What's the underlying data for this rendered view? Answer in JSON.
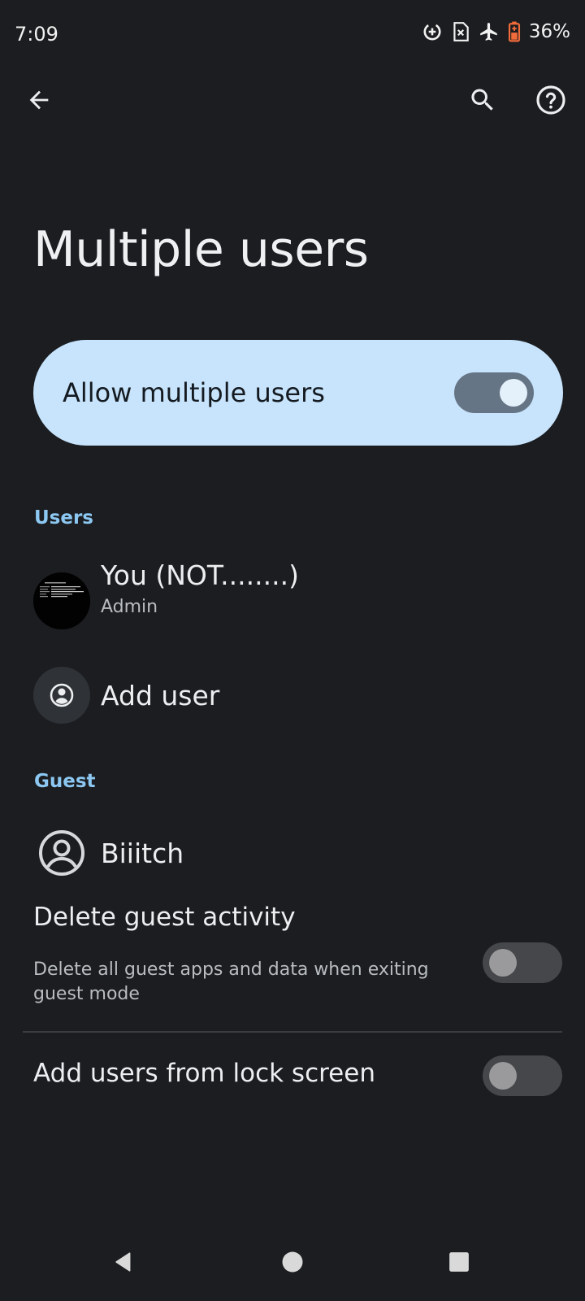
{
  "status_bar": {
    "time": "7:09",
    "battery_percent": "36%",
    "icons": [
      "data-saver-icon",
      "sim-off-icon",
      "airplane-mode-icon",
      "battery-saver-icon"
    ],
    "battery_color": "#f26b3a"
  },
  "app_bar": {
    "back_icon": "arrow-back-icon",
    "search_icon": "search-icon",
    "help_icon": "help-icon"
  },
  "page": {
    "title": "Multiple users"
  },
  "main_switch": {
    "label": "Allow multiple users",
    "checked": true,
    "background": "#c7e4fc"
  },
  "users_section": {
    "header": "Users",
    "current_user": {
      "name": "You (NOT........)",
      "role": "Admin"
    },
    "add_user": {
      "label": "Add user",
      "icon": "account-circle-icon"
    }
  },
  "guest_section": {
    "header": "Guest",
    "guest_user": {
      "name": "Biiitch",
      "icon": "account-circle-outline-icon"
    },
    "delete_guest_activity": {
      "title": "Delete guest activity",
      "summary": "Delete all guest apps and data when exiting guest mode",
      "checked": false
    }
  },
  "lock_screen": {
    "title": "Add users from lock screen",
    "checked": false
  },
  "nav_bar": {
    "back_icon": "nav-back-icon",
    "home_icon": "nav-home-icon",
    "recents_icon": "nav-recents-icon"
  },
  "colors": {
    "background": "#1b1d20",
    "accent": "#8cc8f2"
  }
}
